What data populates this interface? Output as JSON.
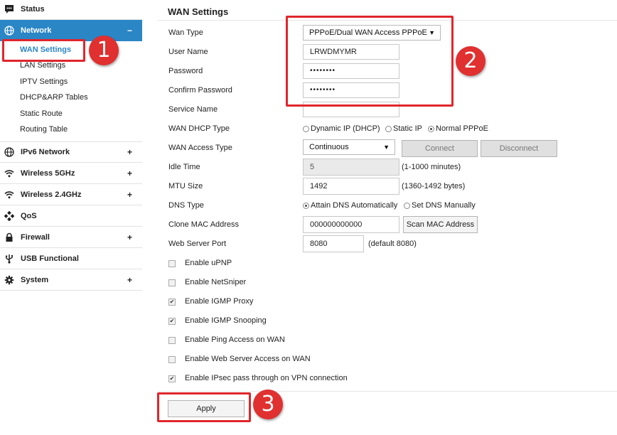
{
  "sidebar": {
    "status": {
      "label": "Status",
      "icon": "chat-icon"
    },
    "network": {
      "label": "Network",
      "sign": "−",
      "icon": "globe-icon"
    },
    "network_sub": [
      "WAN Settings",
      "LAN Settings",
      "IPTV Settings",
      "DHCP&ARP Tables",
      "Static Route",
      "Routing Table"
    ],
    "ipv6": {
      "label": "IPv6 Network",
      "sign": "+",
      "icon": "globe-icon"
    },
    "wireless5": {
      "label": "Wireless 5GHz",
      "sign": "+",
      "icon": "wifi-icon"
    },
    "wireless24": {
      "label": "Wireless 2.4GHz",
      "sign": "+",
      "icon": "wifi-icon"
    },
    "qos": {
      "label": "QoS",
      "icon": "qos-icon"
    },
    "firewall": {
      "label": "Firewall",
      "sign": "+",
      "icon": "lock-icon"
    },
    "usb": {
      "label": "USB Functional",
      "icon": "usb-icon"
    },
    "system": {
      "label": "System",
      "sign": "+",
      "icon": "gear-icon"
    }
  },
  "main": {
    "title": "WAN Settings",
    "labels": {
      "wan_type": "Wan Type",
      "user_name": "User Name",
      "password": "Password",
      "confirm_password": "Confirm Password",
      "service_name": "Service Name",
      "wan_dhcp_type": "WAN DHCP Type",
      "wan_access_type": "WAN Access Type",
      "idle_time": "Idle Time",
      "mtu_size": "MTU Size",
      "dns_type": "DNS Type",
      "clone_mac": "Clone MAC Address",
      "web_server_port": "Web Server Port"
    },
    "wan_type_value": "PPPoE/Dual WAN Access PPPoE",
    "user_name_value": "LRWDMYMR",
    "password_value": "••••••••",
    "confirm_password_value": "••••••••",
    "service_name_value": "",
    "dhcp_options": [
      "Dynamic IP (DHCP)",
      "Static IP",
      "Normal PPPoE"
    ],
    "dhcp_selected": "Normal PPPoE",
    "access_type_value": "Continuous",
    "connect_label": "Connect",
    "disconnect_label": "Disconnect",
    "idle_time_value": "5",
    "idle_time_hint": "(1-1000 minutes)",
    "mtu_value": "1492",
    "mtu_hint": "(1360-1492 bytes)",
    "dns_options": [
      "Attain DNS Automatically",
      "Set DNS Manually"
    ],
    "dns_selected": "Attain DNS Automatically",
    "clone_mac_value": "000000000000",
    "scan_mac_label": "Scan MAC Address",
    "web_port_value": "8080",
    "web_port_hint": "(default 8080)",
    "checkboxes": [
      {
        "label": "Enable uPNP",
        "checked": false
      },
      {
        "label": "Enable NetSniper",
        "checked": false
      },
      {
        "label": "Enable IGMP Proxy",
        "checked": true
      },
      {
        "label": "Enable IGMP Snooping",
        "checked": true
      },
      {
        "label": "Enable Ping Access on WAN",
        "checked": false
      },
      {
        "label": "Enable Web Server Access on WAN",
        "checked": false
      },
      {
        "label": "Enable IPsec pass through on VPN connection",
        "checked": true
      }
    ],
    "apply_label": "Apply"
  },
  "annotations": [
    "1",
    "2",
    "3"
  ],
  "colors": {
    "accent": "#2b86c6",
    "annotation": "#e0262c"
  }
}
